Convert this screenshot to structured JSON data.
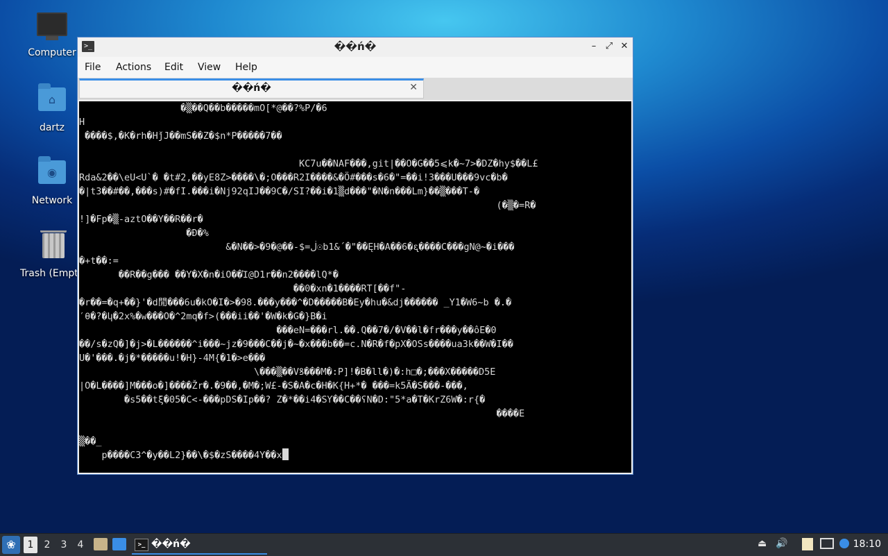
{
  "desktop": {
    "icons": [
      {
        "label": "Computer"
      },
      {
        "label": "dartz"
      },
      {
        "label": "Network"
      },
      {
        "label": "Trash (Empty)"
      }
    ]
  },
  "window": {
    "title": "��ń�",
    "app_icon": ">_",
    "menu": [
      "File",
      "Actions",
      "Edit",
      "View",
      "Help"
    ],
    "tab": {
      "label": "��ń�"
    },
    "terminal_lines": [
      "                  �▒��Q��b�����mO[*@��?%P/�6",
      "H",
      " ����$,�K�rh�HǰJ��mS��Z�$n*P�����7��",
      "",
      "                                       KC7u��NAF���,git|��O�G��5⩽k�~7>�DZ�hy$��L£",
      "Rda&2��\\eU<U`� �t#2,��yE8Z>����\\�;O���R2I����&�Ö#���s�6�\"=��iǃЗ���U���9vc�b�",
      "�|t3��#��,���s)#�fI.���i�Nj92qIJ��9C�/SI?��i�1▒d���\"�N�n���Lm}��▒���T-�",
      "                                                                          (�▒�=R�",
      "!]�Fp�▒-aztO��Y��R��r�",
      "                   �Ɖ�%",
      "                          &�N��>�9�@��-$=ڶ☉b1&´�\"��ĘH�A��6�ᶓ����C���gN@~�i���",
      "�+t��:=",
      "       ��R��g��� ��Y�X�n�iO��Ἰ@D1r��n2����lQ*�",
      "                                      ��0�xn�1����RT[��f\"-",
      "�r��=�q+��}'�d閒���6u�kO�I�>�98.���y���^�D�����B�Ey�hu�&dj������ _Y1�W6~b �.�",
      "′θ�?�կ�2x%�w���O�^2mq�f>(���ii��'�W�k�G�}B�i",
      "                                   ���eN=���rl.��.Q��7�/�V��l�fr���y��ôE�0",
      "��/s�zQ�]�j>�L������^i���~jz�9���C��j�~�x���b��=c.N�R�f�pX�OSs����ua3k��W�I��",
      "U�'���.�j�*�����u!�H}-4M{�1�>e���",
      "                               \\���▒��Vꝸ���M�:P]!�B�ll�)�:h□�;���X�����D5E",
      "|O�L����]M���o�]����Žr�.�9��,�M�;W£-�S�A�c�H�K{H+*� ���=k5Ä�S���-���,",
      "        �s5��tξ�05�C<-���pDS�Ip��? Z�*��i4�SƳ��C��ʕN�D:\"5*a�T�KrZ6W�:r{�",
      "                                                                          ����E",
      "",
      "▒��_",
      "    p����C3^�y��L2}��\\�$�zS����4Y��x"
    ]
  },
  "taskbar": {
    "workspaces": [
      "1",
      "2",
      "3",
      "4"
    ],
    "active_workspace": "1",
    "task_label": "��ń�",
    "clock": "18:10"
  }
}
